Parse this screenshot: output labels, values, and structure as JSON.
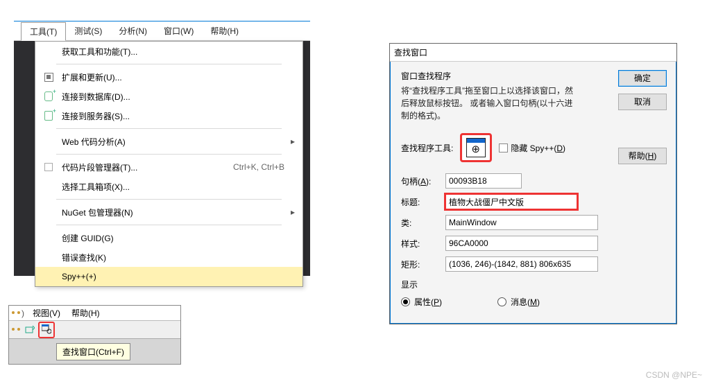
{
  "menubar1": {
    "items": [
      "工具(T)",
      "测试(S)",
      "分析(N)",
      "窗口(W)",
      "帮助(H)"
    ]
  },
  "dropdown": {
    "items": [
      {
        "label": "获取工具和功能(T)...",
        "icon": null,
        "arrow": false,
        "shortcut": ""
      },
      {
        "label": "扩展和更新(U)...",
        "icon": "ext",
        "arrow": false,
        "shortcut": ""
      },
      {
        "label": "连接到数据库(D)...",
        "icon": "db",
        "arrow": false,
        "shortcut": ""
      },
      {
        "label": "连接到服务器(S)...",
        "icon": "srv",
        "arrow": false,
        "shortcut": ""
      },
      {
        "label": "Web 代码分析(A)",
        "icon": null,
        "arrow": true,
        "shortcut": ""
      },
      {
        "label": "代码片段管理器(T)...",
        "icon": "box",
        "arrow": false,
        "shortcut": "Ctrl+K, Ctrl+B"
      },
      {
        "label": "选择工具箱项(X)...",
        "icon": null,
        "arrow": false,
        "shortcut": ""
      },
      {
        "label": "NuGet 包管理器(N)",
        "icon": null,
        "arrow": true,
        "shortcut": ""
      },
      {
        "label": "创建 GUID(G)",
        "icon": null,
        "arrow": false,
        "shortcut": ""
      },
      {
        "label": "错误查找(K)",
        "icon": null,
        "arrow": false,
        "shortcut": ""
      },
      {
        "label": "Spy++(+)",
        "icon": null,
        "arrow": false,
        "shortcut": ""
      }
    ],
    "highlightedIndex": 10
  },
  "panel2": {
    "menubar": [
      "视图(V)",
      "帮助(H)"
    ],
    "tooltip": "查找窗口(Ctrl+F)"
  },
  "dialog": {
    "title": "查找窗口",
    "group": "窗口查找程序",
    "desc": "将“查找程序工具”拖至窗口上以选择该窗口，然后释放鼠标按钮。 或者输入窗口句柄(以十六进制的格式)。",
    "buttons": {
      "ok": "确定",
      "cancel": "取消",
      "help": "帮助(H)"
    },
    "finderLabel": "查找程序工具:",
    "hideLabel": "隐藏 Spy++(D)",
    "fields": {
      "handle": {
        "label": "句柄(A):",
        "value": "00093B18"
      },
      "caption": {
        "label": "标题:",
        "value": "植物大战僵尸中文版"
      },
      "class": {
        "label": "类:",
        "value": "MainWindow"
      },
      "style": {
        "label": "样式:",
        "value": "96CA0000"
      },
      "rect": {
        "label": "矩形:",
        "value": "(1036, 246)-(1842, 881) 806x635"
      }
    },
    "display": {
      "label": "显示",
      "prop": "属性(P)",
      "msg": "消息(M)"
    }
  },
  "watermark": "CSDN @NPE~"
}
